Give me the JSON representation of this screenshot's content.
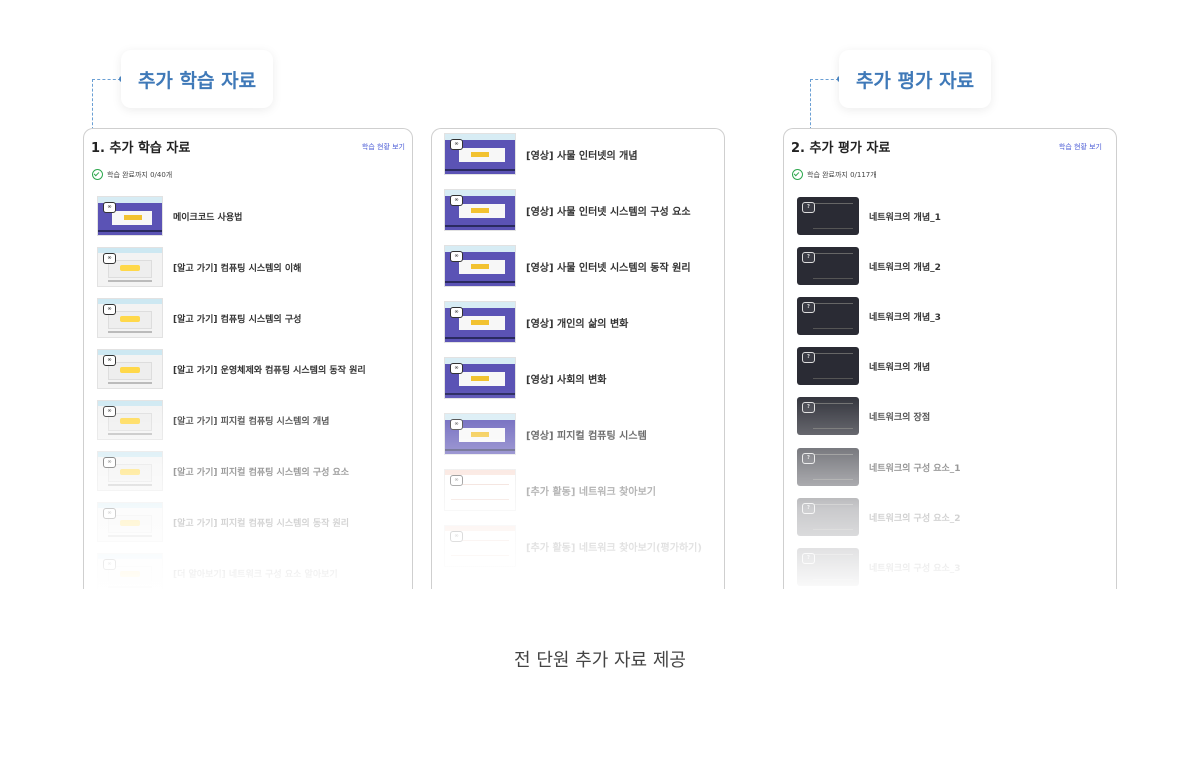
{
  "tags": {
    "left": "추가 학습 자료",
    "right": "추가 평가 자료"
  },
  "panel_a": {
    "title": "1. 추가 학습 자료",
    "link": "학습 현황 보기",
    "progress": "학습 완료까지 0/40개",
    "items": [
      "메이크코드 사용법",
      "[알고 가기] 컴퓨팅 시스템의 이해",
      "[알고 가기] 컴퓨팅 시스템의 구성",
      "[알고 가기] 운영체제와 컴퓨팅 시스템의 동작 원리",
      "[알고 가기] 피지컬 컴퓨팅 시스템의 개념",
      "[알고 가기] 피지컬 컴퓨팅 시스템의 구성 요소",
      "[알고 가기] 피지컬 컴퓨팅 시스템의 동작 원리",
      "[더 알아보기] 네트워크 구성 요소 알아보기"
    ]
  },
  "panel_b": {
    "items": [
      "[영상] 사물 인터넷의 개념",
      "[영상] 사물 인터넷 시스템의 구성 요소",
      "[영상] 사물 인터넷 시스템의 동작 원리",
      "[영상] 개인의 삶의 변화",
      "[영상] 사회의 변화",
      "[영상] 피지컬 컴퓨팅 시스템",
      "[추가 활동] 네트워크 찾아보기",
      "[추가 활동] 네트워크 찾아보기(평가하기)"
    ]
  },
  "panel_c": {
    "title": "2. 추가 평가 자료",
    "link": "학습 현황 보기",
    "progress": "학습 완료까지 0/117개",
    "items": [
      "네트워크의 개념_1",
      "네트워크의 개념_2",
      "네트워크의 개념_3",
      "네트워크의 개념",
      "네트워크의 장점",
      "네트워크의 구성 요소_1",
      "네트워크의 구성 요소_2",
      "네트워크의 구성 요소_3"
    ]
  },
  "badges": {
    "video": "∞",
    "quiz": "?"
  },
  "caption": "전 단원 추가 자료 제공"
}
